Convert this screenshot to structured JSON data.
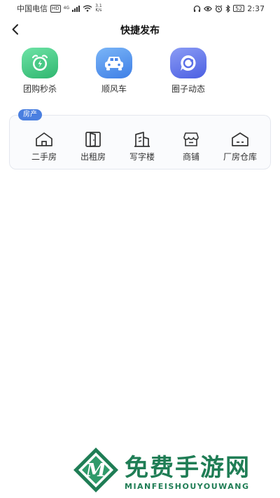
{
  "status_bar": {
    "carrier": "中国电信",
    "hd_badge": "HD",
    "net_type": "4G",
    "speed_value": "3.1",
    "speed_unit": "K/s",
    "battery": "52",
    "time": "2:37"
  },
  "header": {
    "title": "快捷发布"
  },
  "quick_actions": [
    {
      "label": "团购秒杀",
      "icon": "alarm-clock-icon",
      "color": "#37c47e"
    },
    {
      "label": "顺风车",
      "icon": "car-icon",
      "color": "#4a88ea"
    },
    {
      "label": "圈子动态",
      "icon": "chat-bubble-icon",
      "color": "#5a6fe8"
    }
  ],
  "property_section": {
    "tag": "房产",
    "items": [
      {
        "label": "二手房",
        "icon": "house-icon"
      },
      {
        "label": "出租房",
        "icon": "door-icon"
      },
      {
        "label": "写字楼",
        "icon": "office-building-icon"
      },
      {
        "label": "商铺",
        "icon": "shop-icon"
      },
      {
        "label": "厂房仓库",
        "icon": "warehouse-icon"
      }
    ]
  },
  "watermark": {
    "title": "免费手游网",
    "subtitle": "MIANFEISHOUYOUWANG",
    "logo_letter": "M"
  },
  "colors": {
    "accent": "#4a7fe0",
    "watermark_green": "#1f7d55"
  }
}
